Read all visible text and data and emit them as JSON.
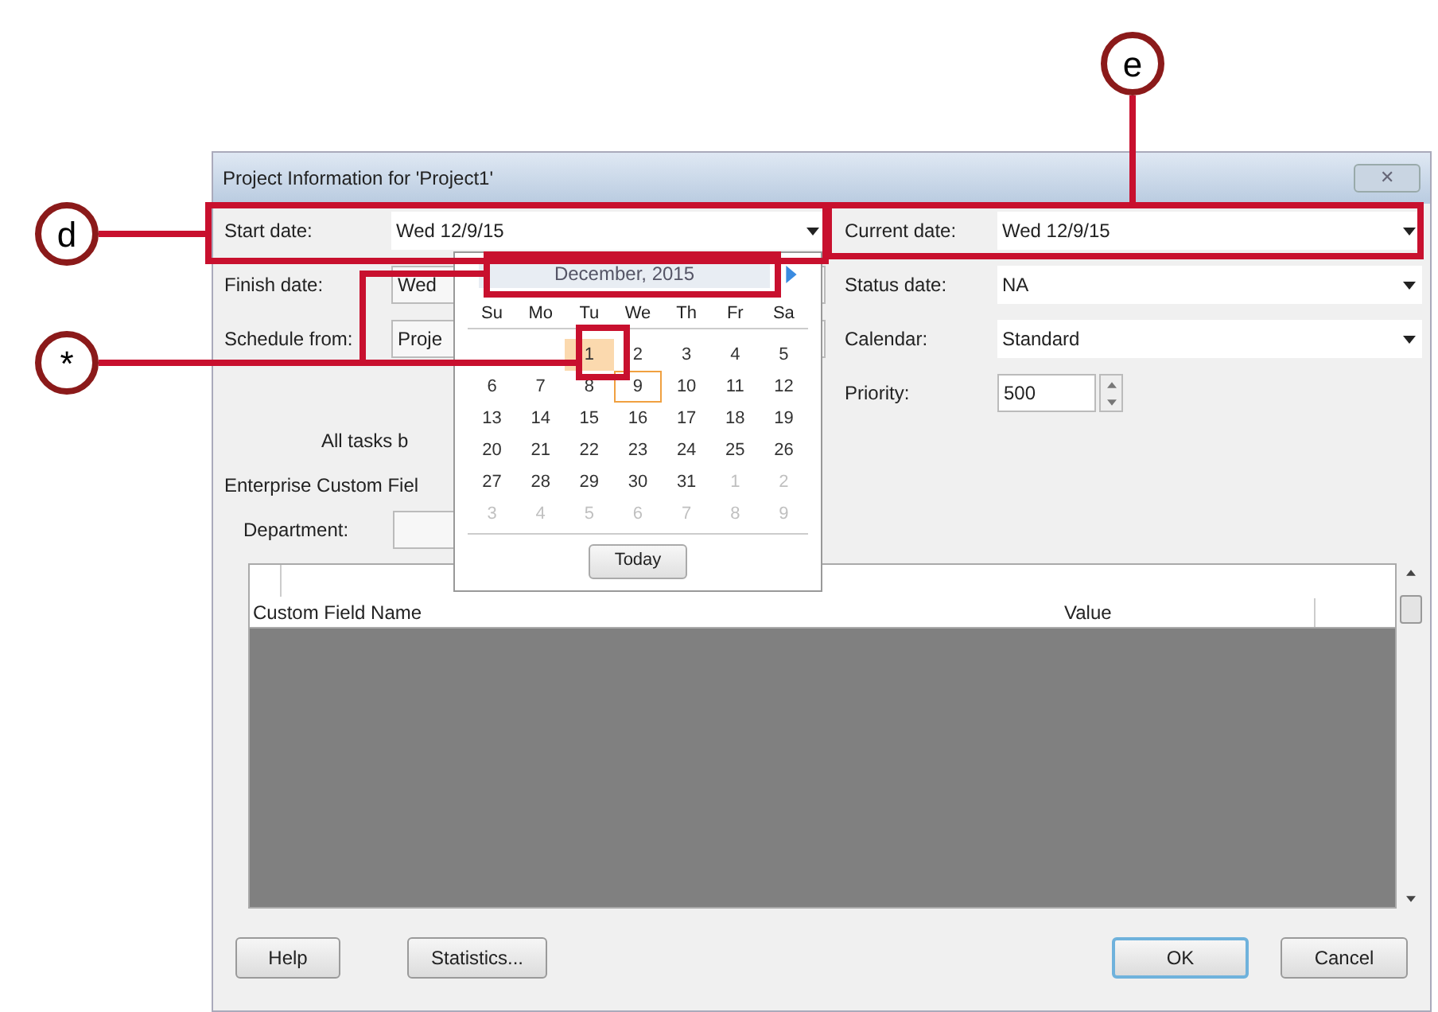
{
  "window": {
    "title": "Project Information for 'Project1'",
    "close": "✕"
  },
  "left_fields": [
    {
      "label": "Start date:",
      "value": "Wed 12/9/15"
    },
    {
      "label": "Finish date:",
      "value": "Wed"
    },
    {
      "label": "Schedule from:",
      "value": "Proje"
    }
  ],
  "right_fields": [
    {
      "kind": "dropdown",
      "label": "Current date:",
      "value": "Wed 12/9/15"
    },
    {
      "kind": "dropdown",
      "label": "Status date:",
      "value": "NA"
    },
    {
      "kind": "dropdown",
      "label": "Calendar:",
      "value": "Standard"
    },
    {
      "kind": "spinner",
      "label": "Priority:",
      "value": "500"
    }
  ],
  "note": "All tasks b",
  "enterprise_heading": "Enterprise Custom Fiel",
  "department": {
    "label": "Department:"
  },
  "table": {
    "columns": [
      "Custom Field Name",
      "Value"
    ]
  },
  "calendar": {
    "month": "December, 2015",
    "weekdays": [
      "Su",
      "Mo",
      "Tu",
      "We",
      "Th",
      "Fr",
      "Sa"
    ],
    "today_button": "Today",
    "weeks": [
      [
        {
          "day": "1",
          "other": false,
          "selected": true,
          "today": false
        },
        {
          "day": "2",
          "other": false,
          "selected": false,
          "today": false
        },
        {
          "day": "3",
          "other": false,
          "selected": false,
          "today": false
        },
        {
          "day": "4",
          "other": false,
          "selected": false,
          "today": false
        },
        {
          "day": "5",
          "other": false,
          "selected": false,
          "today": false
        }
      ],
      [
        {
          "day": "6",
          "other": false,
          "selected": false,
          "today": false
        },
        {
          "day": "7",
          "other": false,
          "selected": false,
          "today": false
        },
        {
          "day": "8",
          "other": false,
          "selected": false,
          "today": false
        },
        {
          "day": "9",
          "other": false,
          "selected": false,
          "today": true
        },
        {
          "day": "10",
          "other": false,
          "selected": false,
          "today": false
        },
        {
          "day": "11",
          "other": false,
          "selected": false,
          "today": false
        },
        {
          "day": "12",
          "other": false,
          "selected": false,
          "today": false
        }
      ],
      [
        {
          "day": "13",
          "other": false,
          "selected": false,
          "today": false
        },
        {
          "day": "14",
          "other": false,
          "selected": false,
          "today": false
        },
        {
          "day": "15",
          "other": false,
          "selected": false,
          "today": false
        },
        {
          "day": "16",
          "other": false,
          "selected": false,
          "today": false
        },
        {
          "day": "17",
          "other": false,
          "selected": false,
          "today": false
        },
        {
          "day": "18",
          "other": false,
          "selected": false,
          "today": false
        },
        {
          "day": "19",
          "other": false,
          "selected": false,
          "today": false
        }
      ],
      [
        {
          "day": "20",
          "other": false,
          "selected": false,
          "today": false
        },
        {
          "day": "21",
          "other": false,
          "selected": false,
          "today": false
        },
        {
          "day": "22",
          "other": false,
          "selected": false,
          "today": false
        },
        {
          "day": "23",
          "other": false,
          "selected": false,
          "today": false
        },
        {
          "day": "24",
          "other": false,
          "selected": false,
          "today": false
        },
        {
          "day": "25",
          "other": false,
          "selected": false,
          "today": false
        },
        {
          "day": "26",
          "other": false,
          "selected": false,
          "today": false
        }
      ],
      [
        {
          "day": "27",
          "other": false,
          "selected": false,
          "today": false
        },
        {
          "day": "28",
          "other": false,
          "selected": false,
          "today": false
        },
        {
          "day": "29",
          "other": false,
          "selected": false,
          "today": false
        },
        {
          "day": "30",
          "other": false,
          "selected": false,
          "today": false
        },
        {
          "day": "31",
          "other": false,
          "selected": false,
          "today": false
        },
        {
          "day": "1",
          "other": true,
          "selected": false,
          "today": false
        },
        {
          "day": "2",
          "other": true,
          "selected": false,
          "today": false
        }
      ],
      [
        {
          "day": "3",
          "other": true,
          "selected": false,
          "today": false
        },
        {
          "day": "4",
          "other": true,
          "selected": false,
          "today": false
        },
        {
          "day": "5",
          "other": true,
          "selected": false,
          "today": false
        },
        {
          "day": "6",
          "other": true,
          "selected": false,
          "today": false
        },
        {
          "day": "7",
          "other": true,
          "selected": false,
          "today": false
        },
        {
          "day": "8",
          "other": true,
          "selected": false,
          "today": false
        },
        {
          "day": "9",
          "other": true,
          "selected": false,
          "today": false
        }
      ]
    ]
  },
  "buttons": [
    {
      "label": "Help",
      "default": false
    },
    {
      "label": "Statistics...",
      "default": false
    },
    {
      "label": "OK",
      "default": true
    },
    {
      "label": "Cancel",
      "default": false
    }
  ],
  "annotations": [
    {
      "label": "d"
    },
    {
      "label": "e"
    },
    {
      "label": "*"
    }
  ]
}
